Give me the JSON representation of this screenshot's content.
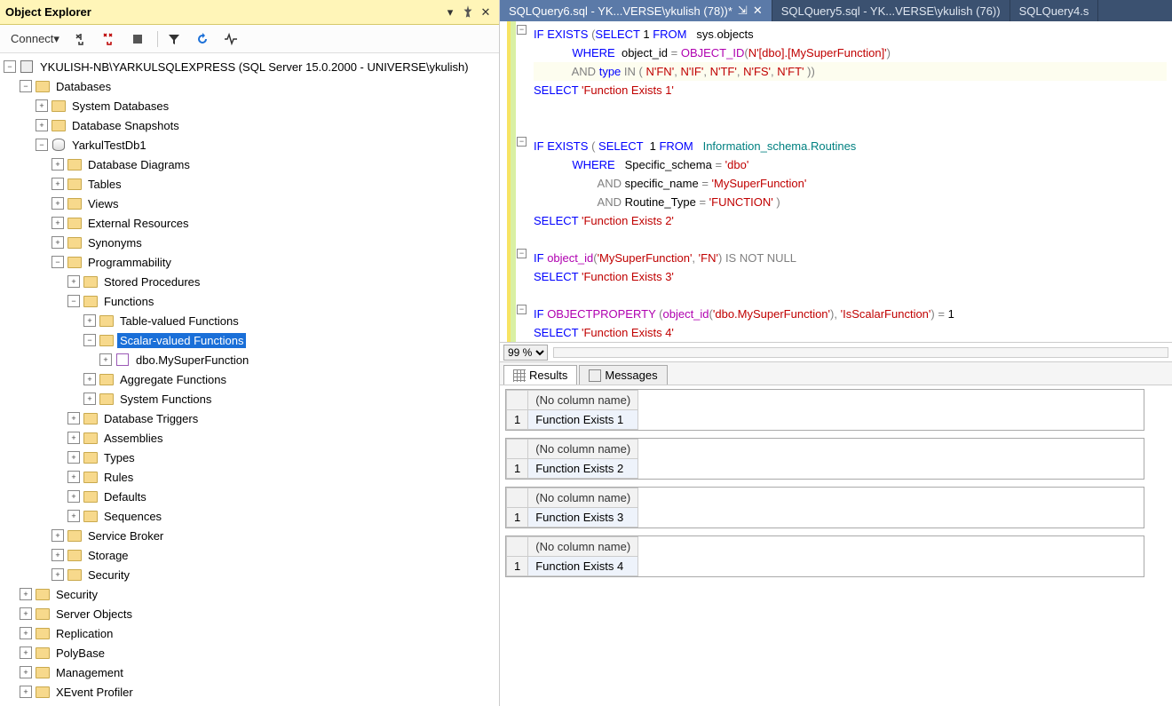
{
  "panel": {
    "title": "Object Explorer"
  },
  "toolbar": {
    "connect": "Connect"
  },
  "tree": {
    "server": "YKULISH-NB\\YARKULSQLEXPRESS (SQL Server 15.0.2000 - UNIVERSE\\ykulish)",
    "databases": "Databases",
    "sysdb": "System Databases",
    "snapshots": "Database Snapshots",
    "testdb": "YarkulTestDb1",
    "diagrams": "Database Diagrams",
    "tables": "Tables",
    "views": "Views",
    "extres": "External Resources",
    "synonyms": "Synonyms",
    "prog": "Programmability",
    "sp": "Stored Procedures",
    "functions": "Functions",
    "tvf": "Table-valued Functions",
    "svf": "Scalar-valued Functions",
    "myfn": "dbo.MySuperFunction",
    "aggfn": "Aggregate Functions",
    "sysfn": "System Functions",
    "trig": "Database Triggers",
    "asm": "Assemblies",
    "types": "Types",
    "rules": "Rules",
    "defaults": "Defaults",
    "seq": "Sequences",
    "sb": "Service Broker",
    "storage": "Storage",
    "sec": "Security",
    "sec2": "Security",
    "srvobj": "Server Objects",
    "repl": "Replication",
    "poly": "PolyBase",
    "mgmt": "Management",
    "xev": "XEvent Profiler"
  },
  "tabs": {
    "t1": "SQLQuery6.sql - YK...VERSE\\ykulish (78))*",
    "t2": "SQLQuery5.sql - YK...VERSE\\ykulish (76))",
    "t3": "SQLQuery4.s"
  },
  "zoom": "99 %",
  "resultTabs": {
    "results": "Results",
    "messages": "Messages"
  },
  "grid": {
    "header": "(No column name)",
    "r1": "Function Exists 1",
    "r2": "Function Exists 2",
    "r3": "Function Exists 3",
    "r4": "Function Exists 4"
  }
}
